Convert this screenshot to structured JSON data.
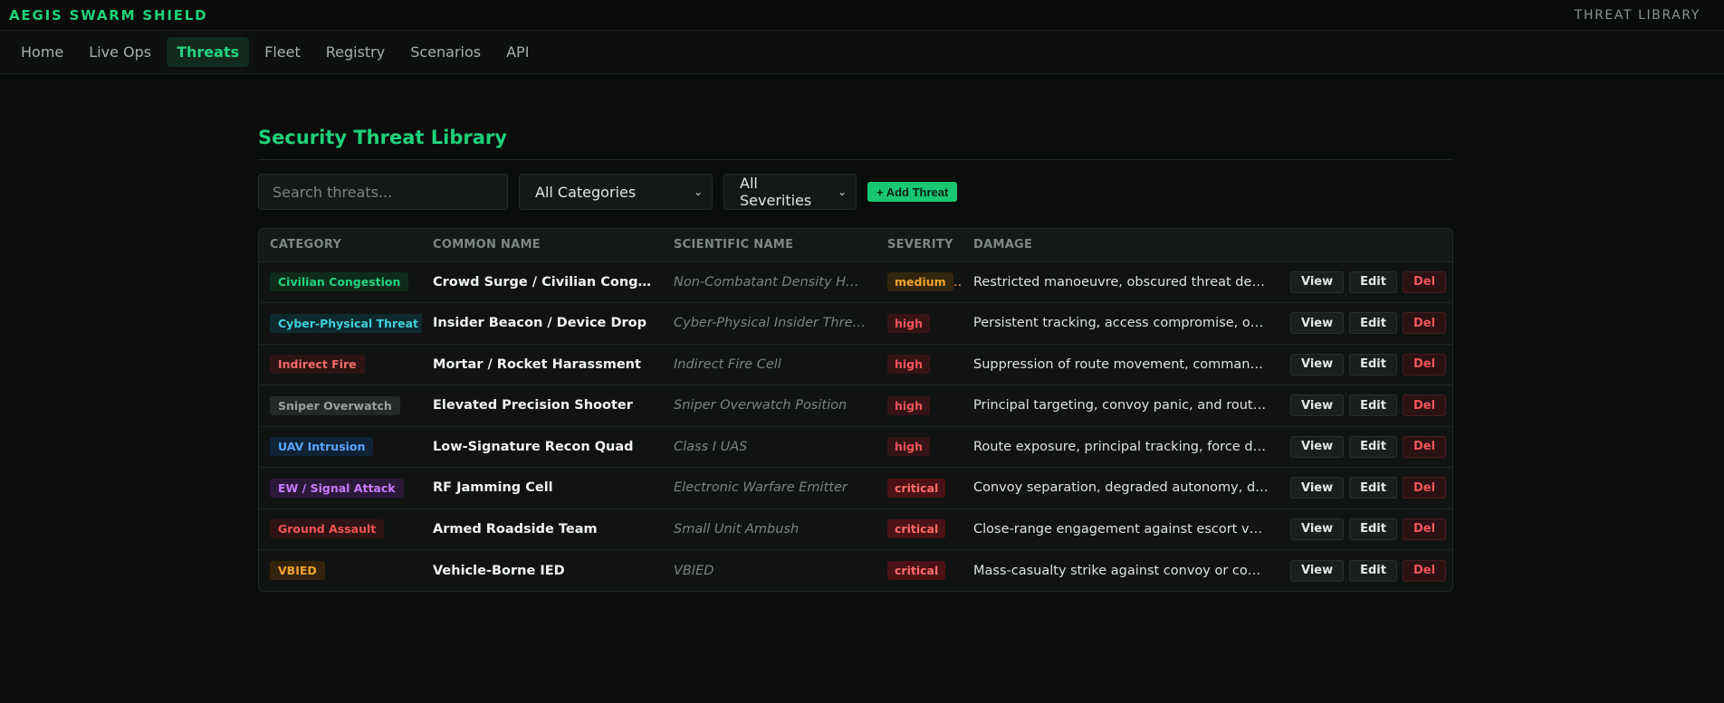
{
  "app": {
    "brand": "AEGIS SWARM SHIELD",
    "section": "THREAT LIBRARY"
  },
  "nav": [
    {
      "label": "Home",
      "active": false
    },
    {
      "label": "Live Ops",
      "active": false
    },
    {
      "label": "Threats",
      "active": true
    },
    {
      "label": "Fleet",
      "active": false
    },
    {
      "label": "Registry",
      "active": false
    },
    {
      "label": "Scenarios",
      "active": false
    },
    {
      "label": "API",
      "active": false
    }
  ],
  "page": {
    "title": "Security Threat Library"
  },
  "controls": {
    "search_placeholder": "Search threats...",
    "category_select": "All Categories",
    "severity_select": "All Severities",
    "add_label": "+ Add Threat"
  },
  "table": {
    "headers": [
      "CATEGORY",
      "COMMON NAME",
      "SCIENTIFIC NAME",
      "SEVERITY",
      "DAMAGE"
    ],
    "action_labels": {
      "view": "View",
      "edit": "Edit",
      "del": "Del"
    },
    "rows": [
      {
        "category": "Civilian Congestion",
        "common": "Crowd Surge / Civilian Congestion",
        "scientific": "Non-Combatant Density Hazard",
        "severity": "medium",
        "damage": "Restricted manoeuvre, obscured threat detection, and civilian exposure"
      },
      {
        "category": "Cyber-Physical Threat",
        "common": "Insider Beacon / Device Drop",
        "scientific": "Cyber-Physical Insider Threat",
        "severity": "high",
        "damage": "Persistent tracking, access compromise, or cueing of external attackers"
      },
      {
        "category": "Indirect Fire",
        "common": "Mortar / Rocket Harassment",
        "scientific": "Indirect Fire Cell",
        "severity": "high",
        "damage": "Suppression of route movement, command disruption and casualties"
      },
      {
        "category": "Sniper Overwatch",
        "common": "Elevated Precision Shooter",
        "scientific": "Sniper Overwatch Position",
        "severity": "high",
        "damage": "Principal targeting, convoy panic, and route lock-down"
      },
      {
        "category": "UAV Intrusion",
        "common": "Low-Signature Recon Quad",
        "scientific": "Class I UAS",
        "severity": "high",
        "damage": "Route exposure, principal tracking, force disposition leakage"
      },
      {
        "category": "EW / Signal Attack",
        "common": "RF Jamming Cell",
        "scientific": "Electronic Warfare Emitter",
        "severity": "critical",
        "damage": "Convoy separation, degraded autonomy, delayed interception"
      },
      {
        "category": "Ground Assault",
        "common": "Armed Roadside Team",
        "scientific": "Small Unit Ambush",
        "severity": "critical",
        "damage": "Close-range engagement against escort vehicles and principal"
      },
      {
        "category": "VBIED",
        "common": "Vehicle-Borne IED",
        "scientific": "VBIED",
        "severity": "critical",
        "damage": "Mass-casualty strike against convoy or command post"
      }
    ]
  },
  "colors": {
    "accent": "#1ed27a",
    "background": "#0b0d0c"
  }
}
